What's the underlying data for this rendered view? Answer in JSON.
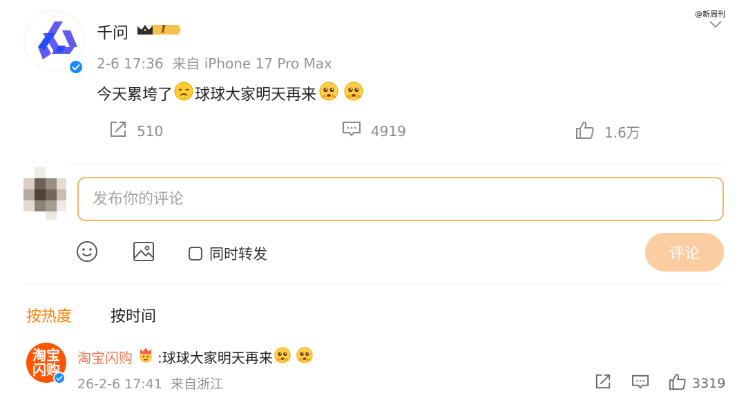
{
  "watermark": "@新周刊",
  "post": {
    "author": "千问",
    "level_badge": "I",
    "meta": "2-6 17:36  来自 iPhone 17 Pro Max",
    "text_part1": "今天累垮了",
    "text_part2": "球球大家明天再来",
    "emoji_icons": [
      "tired-face-icon",
      "pleading-face-icon",
      "pleading-face-icon"
    ],
    "stats": {
      "repost": "510",
      "comment": "4919",
      "like": "1.6万"
    }
  },
  "composer": {
    "placeholder": "发布你的评论",
    "repost_label": "同时转发",
    "submit_label": "评论"
  },
  "sort_tabs": {
    "hot": "按热度",
    "time": "按时间"
  },
  "comment": {
    "author": "淘宝闪购",
    "avatar_text": "淘宝闪购",
    "text": ":球球大家明天再来",
    "meta": "26-2-6 17:41  来自浙江",
    "likes": "3319"
  },
  "colors": {
    "accent": "#ff8200",
    "verified": "#1a8cff",
    "input_border": "#f5b45f",
    "submit_bg": "#fccda0",
    "comment_author": "#eb7350"
  }
}
